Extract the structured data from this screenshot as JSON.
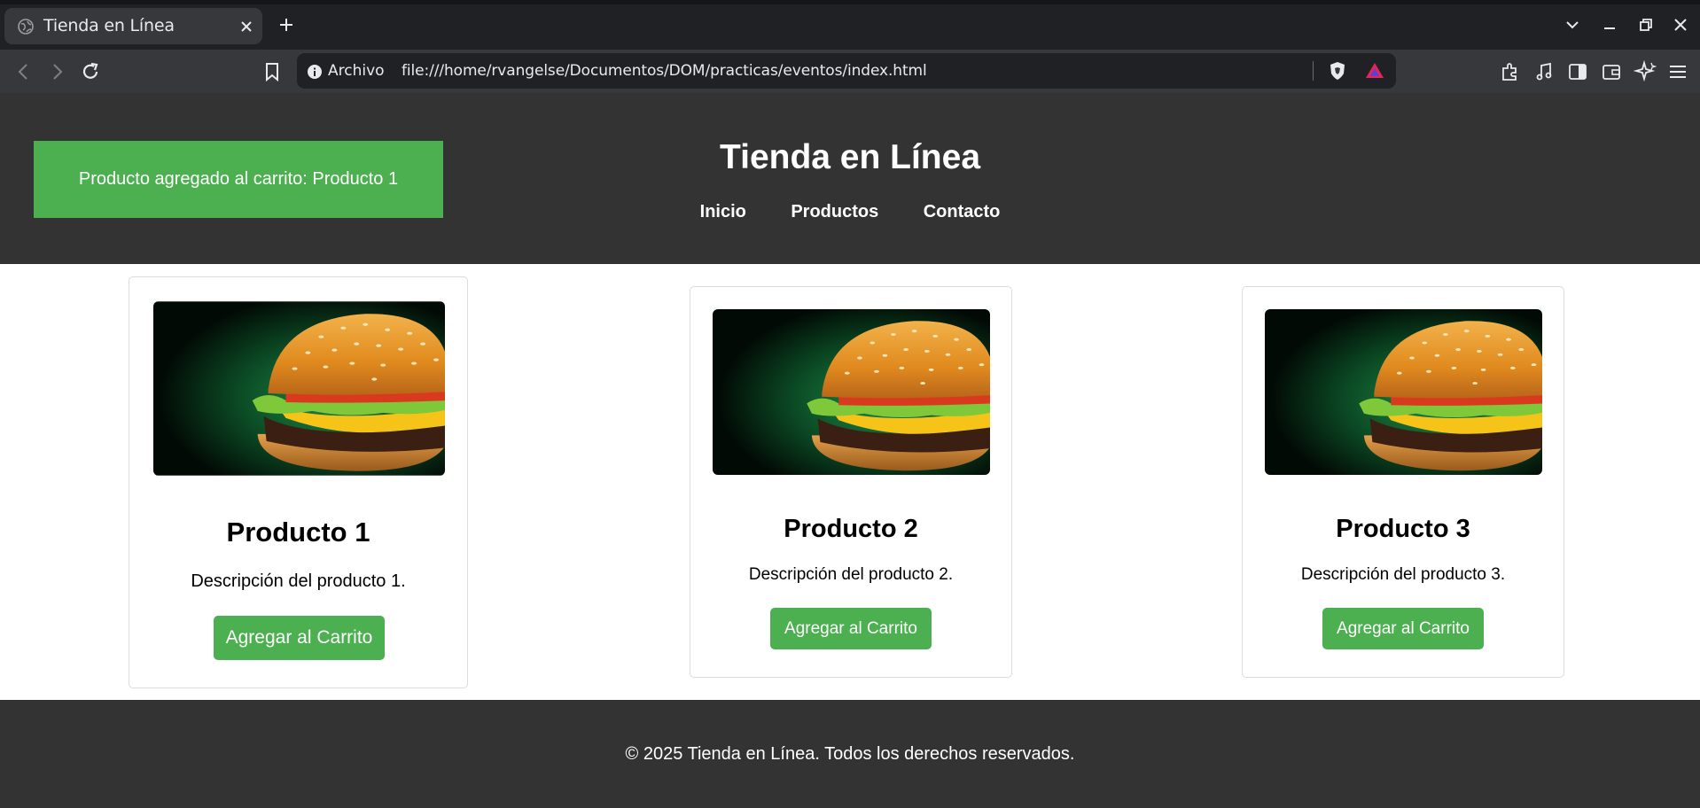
{
  "browser": {
    "tab_title": "Tienda en Línea",
    "address_scheme": "Archivo",
    "address_url": "file:///home/rvangelse/Documentos/DOM/practicas/eventos/index.html"
  },
  "site": {
    "notification": "Producto agregado al carrito: Producto 1",
    "title": "Tienda en Línea",
    "nav": [
      "Inicio",
      "Productos",
      "Contacto"
    ],
    "accent_color": "#4caf50",
    "header_color": "#333333"
  },
  "products": [
    {
      "name": "Producto 1",
      "description": "Descripción del producto 1.",
      "button": "Agregar al Carrito"
    },
    {
      "name": "Producto 2",
      "description": "Descripción del producto 2.",
      "button": "Agregar al Carrito"
    },
    {
      "name": "Producto 3",
      "description": "Descripción del producto 3.",
      "button": "Agregar al Carrito"
    }
  ],
  "footer": {
    "text": "© 2025 Tienda en Línea. Todos los derechos reservados."
  }
}
